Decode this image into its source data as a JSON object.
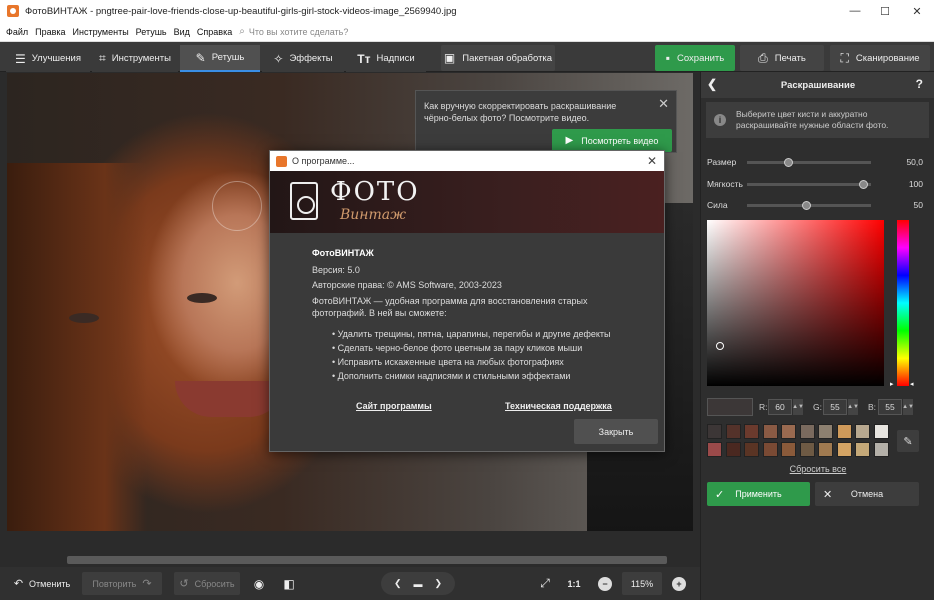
{
  "window": {
    "title": "ФотоВИНТАЖ - pngtree-pair-love-friends-close-up-beautiful-girls-girl-stock-videos-image_2569940.jpg",
    "min": "—",
    "max": "☐",
    "close": "✕"
  },
  "menu": {
    "items": [
      "Файл",
      "Правка",
      "Инструменты",
      "Ретушь",
      "Вид",
      "Справка"
    ],
    "search_placeholder": "Что вы хотите сделать?"
  },
  "tabs": [
    {
      "label": "Улучшения",
      "icon": "sliders-icon"
    },
    {
      "label": "Инструменты",
      "icon": "crop-icon"
    },
    {
      "label": "Ретушь",
      "icon": "brush-icon"
    },
    {
      "label": "Эффекты",
      "icon": "magic-wand-icon"
    },
    {
      "label": "Надписи",
      "icon": "text-icon"
    }
  ],
  "active_tab": "Ретушь",
  "toolbar": {
    "batch": "Пакетная обработка",
    "save": "Сохранить",
    "print": "Печать",
    "scan": "Сканирование"
  },
  "tip": {
    "text": "Как вручную скорректировать раскрашивание чёрно-белых фото? Посмотрите видео.",
    "button": "Посмотреть видео"
  },
  "about": {
    "title": "О программе...",
    "logo_top": "ФОТО",
    "logo_bottom": "Винтаж",
    "name": "ФотоВИНТАЖ",
    "version": "Версия: 5.0",
    "copyright": "Авторские права: © AMS Software, 2003-2023",
    "description": "ФотоВИНТАЖ — удобная программа для восстановления старых фотографий. В ней вы сможете:",
    "features": [
      "• Удалить трещины, пятна, царапины, перегибы и другие дефекты",
      "• Сделать черно-белое фото цветным за пару кликов мыши",
      "• Исправить искаженные цвета на любых фотографиях",
      "• Дополнить снимки надписями и стильными эффектами"
    ],
    "site_link": "Сайт программы",
    "support_link": "Техническая поддержка",
    "close_button": "Закрыть"
  },
  "bottom": {
    "undo": "Отменить",
    "redo": "Повторить",
    "reset": "Сбросить",
    "ratio": "1:1",
    "zoom": "115%"
  },
  "panel": {
    "title": "Раскрашивание",
    "help": "?",
    "info": "Выберите цвет кисти и аккуратно раскрашивайте нужные области фото.",
    "sliders": [
      {
        "label": "Размер",
        "value": "50,0",
        "fraction": 0.33
      },
      {
        "label": "Мягкость",
        "value": "100",
        "fraction": 1.0
      },
      {
        "label": "Сила",
        "value": "50",
        "fraction": 0.47
      }
    ],
    "rgb": {
      "r_label": "R:",
      "r": "60",
      "g_label": "G:",
      "g": "55",
      "b_label": "B:",
      "b": "55"
    },
    "current_color": "#3c3737",
    "swatches": [
      "#3c3636",
      "#54322a",
      "#6b3a2d",
      "#8a5a44",
      "#9a6a50",
      "#7a6a5e",
      "#8d8070",
      "#cf9a5a",
      "#b8a88f",
      "#e7e5e0",
      "#9b4a4a",
      "#4a2820",
      "#5a3424",
      "#7a4a34",
      "#8a5a3a",
      "#6e5a44",
      "#a07a50",
      "#d4a464",
      "#c4a878",
      "#b4b0a8"
    ],
    "reset_all": "Сбросить все",
    "apply": "Применить",
    "cancel": "Отмена"
  }
}
